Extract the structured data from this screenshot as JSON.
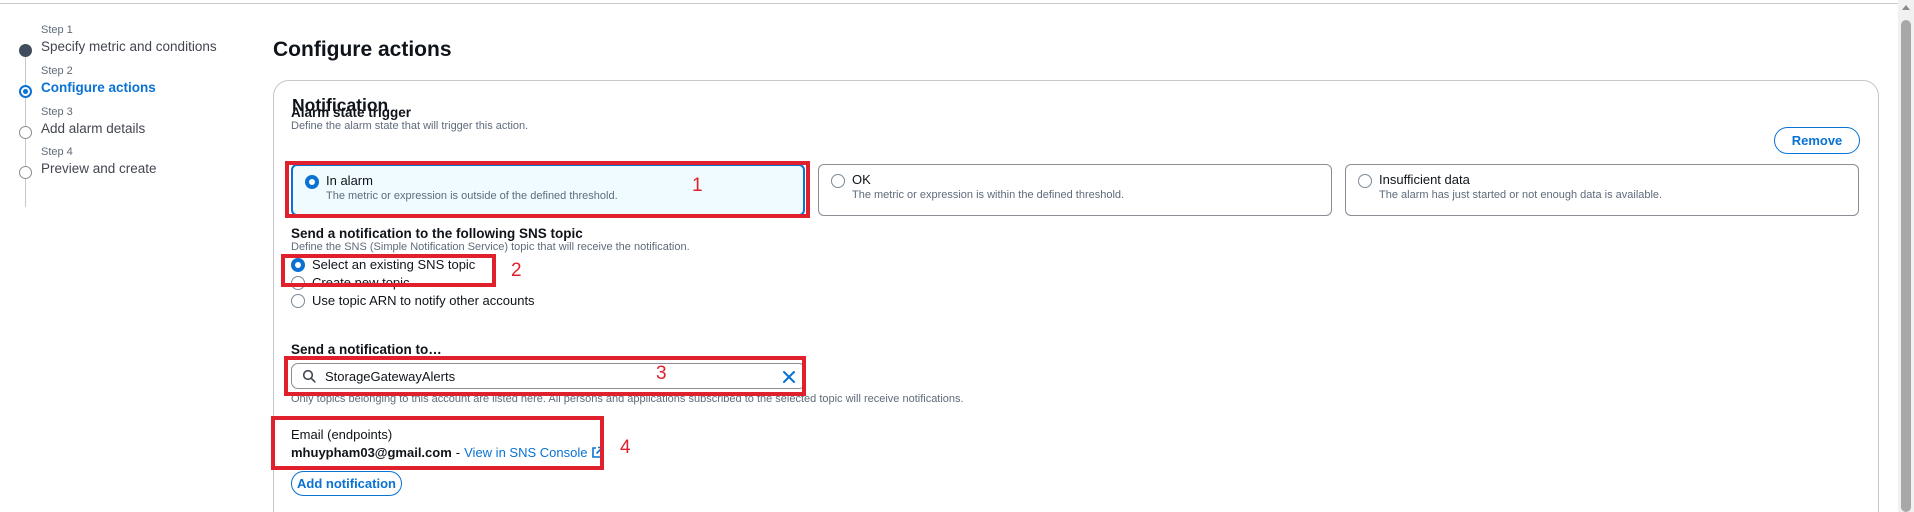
{
  "steps": [
    {
      "num": "Step 1",
      "label": "Specify metric and conditions",
      "state": "done"
    },
    {
      "num": "Step 2",
      "label": "Configure actions",
      "state": "active"
    },
    {
      "num": "Step 3",
      "label": "Add alarm details",
      "state": "future"
    },
    {
      "num": "Step 4",
      "label": "Preview and create",
      "state": "future"
    }
  ],
  "page_title": "Configure actions",
  "notification": {
    "title": "Notification",
    "remove_label": "Remove",
    "alarm_state": {
      "label": "Alarm state trigger",
      "description": "Define the alarm state that will trigger this action.",
      "options": [
        {
          "label": "In alarm",
          "description": "The metric or expression is outside of the defined threshold.",
          "selected": true
        },
        {
          "label": "OK",
          "description": "The metric or expression is within the defined threshold.",
          "selected": false
        },
        {
          "label": "Insufficient data",
          "description": "The alarm has just started or not enough data is available.",
          "selected": false
        }
      ]
    },
    "sns": {
      "label": "Send a notification to the following SNS topic",
      "description": "Define the SNS (Simple Notification Service) topic that will receive the notification.",
      "options": [
        {
          "label": "Select an existing SNS topic",
          "selected": true
        },
        {
          "label": "Create new topic",
          "selected": false
        },
        {
          "label": "Use topic ARN to notify other accounts",
          "selected": false
        }
      ]
    },
    "send_to": {
      "label": "Send a notification to…",
      "value": "StorageGatewayAlerts",
      "description": "Only topics belonging to this account are listed here. All persons and applications subscribed to the selected topic will receive notifications."
    },
    "email": {
      "label": "Email (endpoints)",
      "address": "mhuypham03@gmail.com",
      "separator": "-",
      "link": "View in SNS Console"
    },
    "add_label": "Add notification"
  },
  "annotations": [
    "1",
    "2",
    "3",
    "4"
  ],
  "colors": {
    "accent": "#0972d3",
    "annotation": "#e0202c",
    "selected_bg": "#f0fbff"
  },
  "icons": [
    "search-icon",
    "clear-icon",
    "external-link-icon"
  ]
}
